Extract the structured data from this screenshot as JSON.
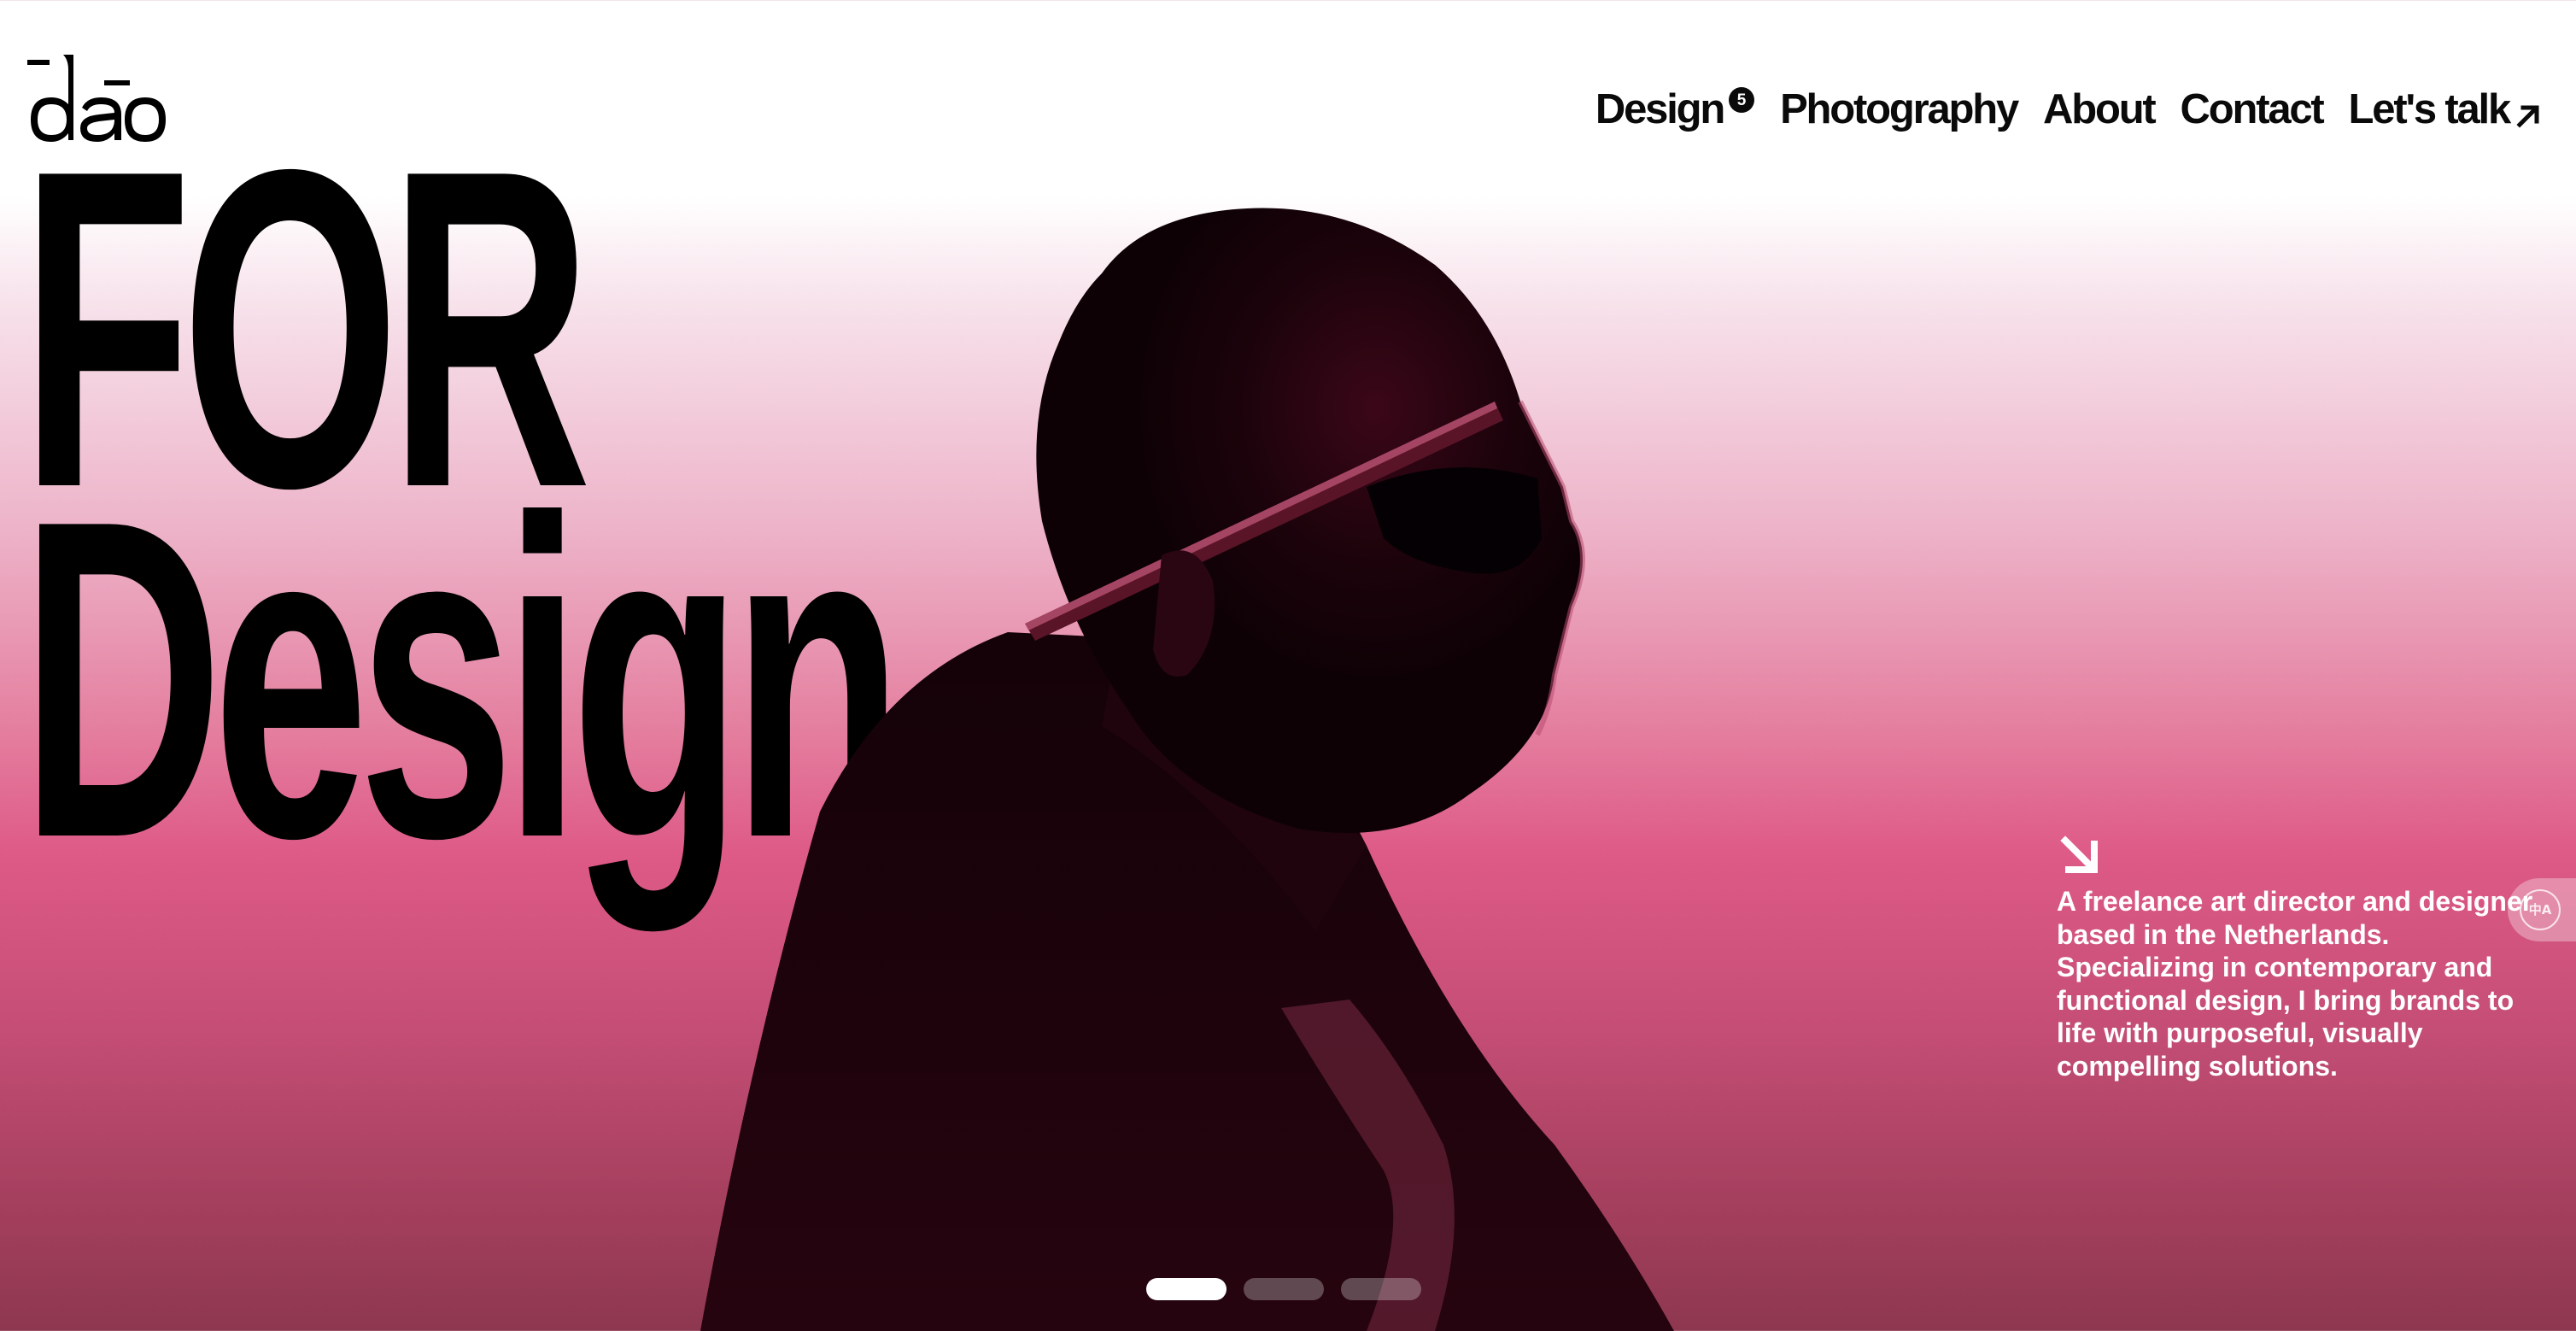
{
  "brand": {
    "logo_text": "dāo",
    "accent_color": "#de5a87"
  },
  "nav": {
    "items": [
      {
        "label": "Design",
        "badge": "5"
      },
      {
        "label": "Photography"
      },
      {
        "label": "About"
      },
      {
        "label": "Contact"
      },
      {
        "label": "Let's talk",
        "icon": "arrow-up-right-icon"
      }
    ]
  },
  "hero": {
    "headline_line1": "FOR",
    "headline_line2": "Design",
    "image": "pink-duotone-profile-portrait"
  },
  "intro": {
    "icon": "arrow-down-right-icon",
    "text": "A freelance art director and designer based in the Netherlands. Specializing in contemporary and functional design, I bring brands to life with purposeful, visually compelling solutions."
  },
  "translate_button": {
    "icon": "translate-icon",
    "label": "中A"
  },
  "carousel": {
    "total": 3,
    "active": 1
  }
}
